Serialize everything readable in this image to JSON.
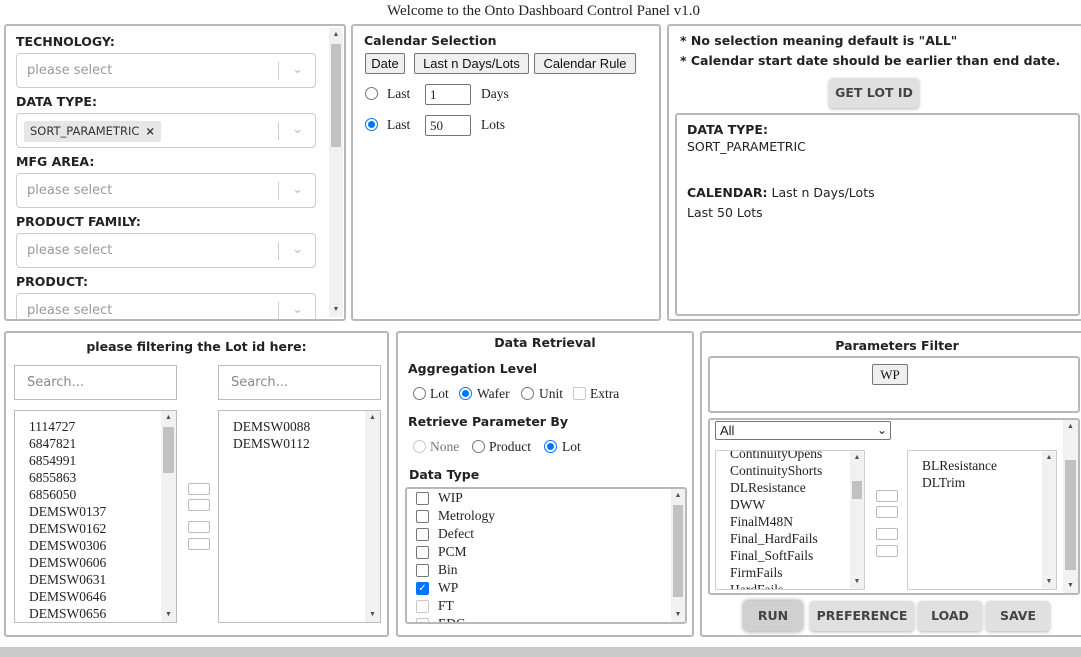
{
  "header": {
    "title": "Welcome to the Onto Dashboard Control Panel v1.0"
  },
  "filters": {
    "technology": {
      "label": "TECHNOLOGY:",
      "placeholder": "please select"
    },
    "data_type": {
      "label": "DATA TYPE:",
      "selected": "SORT_PARAMETRIC",
      "remove": "×"
    },
    "mfg_area": {
      "label": "MFG AREA:",
      "placeholder": "please select"
    },
    "product_family": {
      "label": "PRODUCT FAMILY:",
      "placeholder": "please select"
    },
    "product": {
      "label": "PRODUCT:",
      "placeholder": "please select"
    }
  },
  "calendar": {
    "title": "Calendar Selection",
    "buttons": [
      "Date",
      "Last n Days/Lots",
      "Calendar Rule"
    ],
    "days_row": {
      "prefix": "Last",
      "value": "1",
      "suffix": "Days"
    },
    "lots_row": {
      "prefix": "Last",
      "value": "50",
      "suffix": "Lots"
    }
  },
  "notes": {
    "line1": "* No selection meaning default is \"ALL\"",
    "line2": "* Calendar start date should be earlier than end date.",
    "get_lot_button": "GET LOT ID"
  },
  "summary": {
    "data_type_label": "DATA TYPE:",
    "data_type_value": "SORT_PARAMETRIC",
    "calendar_label": "CALENDAR:",
    "calendar_value": "Last n Days/Lots",
    "calendar_detail": "Last 50 Lots"
  },
  "lot_filter": {
    "title": "please filtering the Lot id here:",
    "search_placeholder_left": "Search...",
    "search_placeholder_right": "Search...",
    "available": [
      "1114727",
      "6847821",
      "6854991",
      "6855863",
      "6856050",
      "DEMSW0137",
      "DEMSW0162",
      "DEMSW0306",
      "DEMSW0606",
      "DEMSW0631",
      "DEMSW0646",
      "DEMSW0656"
    ],
    "selected": [
      "DEMSW0088",
      "DEMSW0112"
    ]
  },
  "retrieval": {
    "title": "Data Retrieval",
    "agg_label": "Aggregation Level",
    "agg_options": [
      "Lot",
      "Wafer",
      "Unit",
      "Extra"
    ],
    "by_label": "Retrieve Parameter By",
    "by_options": [
      "None",
      "Product",
      "Lot"
    ],
    "type_label": "Data Type",
    "types": [
      "WIP",
      "Metrology",
      "Defect",
      "PCM",
      "Bin",
      "WP",
      "FT",
      "EDC"
    ]
  },
  "params": {
    "title": "Parameters Filter",
    "tag": "WP",
    "dropdown": "All",
    "available": [
      "ContinuityOpens",
      "ContinuityShorts",
      "DLResistance",
      "DWW",
      "FinalM48N",
      "Final_HardFails",
      "Final_SoftFails",
      "FirmFails",
      "HardFails"
    ],
    "selected": [
      "BLResistance",
      "DLTrim"
    ]
  },
  "actions": {
    "run": "RUN",
    "preference": "PREFERENCE",
    "load": "LOAD",
    "save": "SAVE"
  }
}
